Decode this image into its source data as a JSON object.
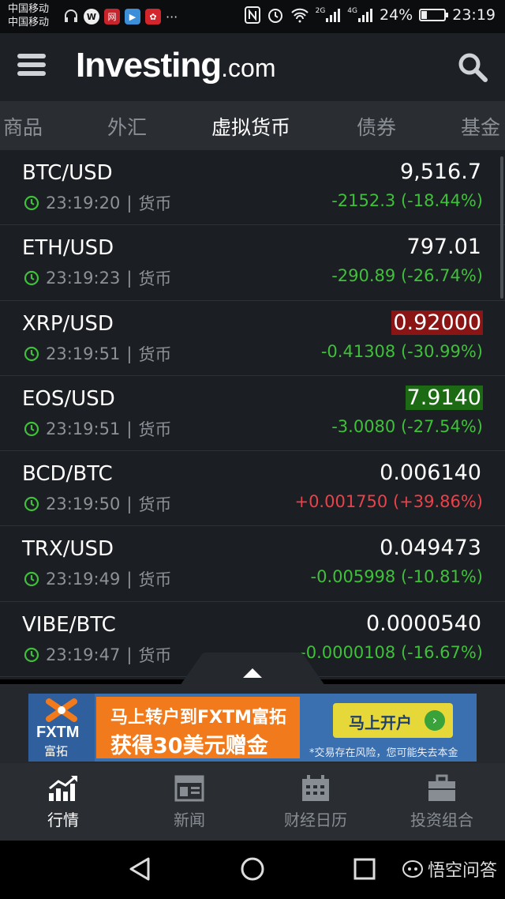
{
  "status_bar": {
    "carrier_1": "中国移动",
    "carrier_2": "中国移动",
    "notif_icons": [
      "headset-icon",
      "w-app-icon",
      "news-app-icon",
      "video-app-icon",
      "huawei-app-icon"
    ],
    "more": "···",
    "battery_level": 0.24,
    "battery": "24%",
    "time": "23:19",
    "net1": "2G",
    "net2": "4G"
  },
  "header": {
    "logo_main": "Investing",
    "logo_suffix": ".com"
  },
  "tabs": [
    {
      "label": "商品",
      "active": false
    },
    {
      "label": "外汇",
      "active": false
    },
    {
      "label": "虚拟货币",
      "active": true
    },
    {
      "label": "债券",
      "active": false
    },
    {
      "label": "基金",
      "active": false
    }
  ],
  "quotes": [
    {
      "pair": "BTC/USD",
      "time": "23:19:20",
      "sep": "|",
      "type": "货币",
      "price": "9,516.7",
      "change": "-2152.3 (-18.44%)",
      "direction": "down",
      "flash": "none"
    },
    {
      "pair": "ETH/USD",
      "time": "23:19:23",
      "sep": "|",
      "type": "货币",
      "price": "797.01",
      "change": "-290.89 (-26.74%)",
      "direction": "down",
      "flash": "none"
    },
    {
      "pair": "XRP/USD",
      "time": "23:19:51",
      "sep": "|",
      "type": "货币",
      "price": "0.92000",
      "change": "-0.41308 (-30.99%)",
      "direction": "down",
      "flash": "red"
    },
    {
      "pair": "EOS/USD",
      "time": "23:19:51",
      "sep": "|",
      "type": "货币",
      "price": "7.9140",
      "change": "-3.0080 (-27.54%)",
      "direction": "down",
      "flash": "green"
    },
    {
      "pair": "BCD/BTC",
      "time": "23:19:50",
      "sep": "|",
      "type": "货币",
      "price": "0.006140",
      "change": "+0.001750 (+39.86%)",
      "direction": "up",
      "flash": "none"
    },
    {
      "pair": "TRX/USD",
      "time": "23:19:49",
      "sep": "|",
      "type": "货币",
      "price": "0.049473",
      "change": "-0.005998 (-10.81%)",
      "direction": "down",
      "flash": "none"
    },
    {
      "pair": "VIBE/BTC",
      "time": "23:19:47",
      "sep": "|",
      "type": "货币",
      "price": "0.0000540",
      "change": "-0.0000108 (-16.67%)",
      "direction": "down",
      "flash": "none"
    }
  ],
  "ad": {
    "brand": "FXTM",
    "brand_cn": "富拓",
    "line1": "马上转户到FXTM富拓",
    "line2": "获得30美元赠金",
    "button": "马上开户",
    "button_arrow": "›",
    "disclaimer": "*交易存在风险，您可能失去本金"
  },
  "bottom_nav": [
    {
      "label": "行情",
      "icon": "chart-icon",
      "active": true
    },
    {
      "label": "新闻",
      "icon": "newspaper-icon",
      "active": false
    },
    {
      "label": "财经日历",
      "icon": "calendar-icon",
      "active": false
    },
    {
      "label": "投资组合",
      "icon": "briefcase-icon",
      "active": false
    }
  ],
  "watermark": "悟空问答",
  "colors": {
    "negative": "#3fc03a",
    "positive": "#e9424a",
    "flash_red": "#8b1414",
    "flash_green": "#1d6a14",
    "background": "#1b1e22"
  }
}
